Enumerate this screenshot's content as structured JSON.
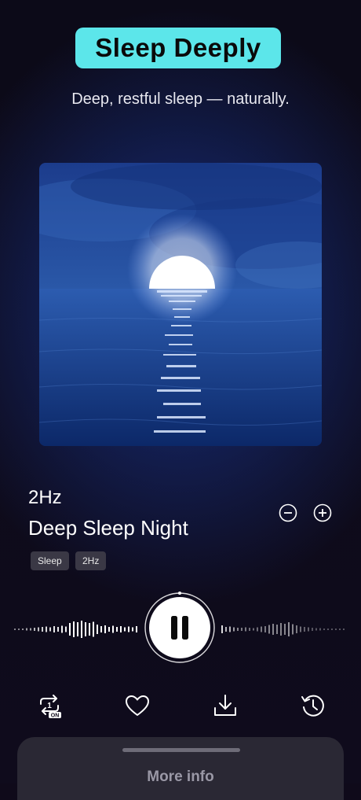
{
  "header": {
    "title": "Sleep Deeply",
    "subtitle": "Deep, restful sleep — naturally."
  },
  "artwork": {
    "description_icon": "moonlit-ocean-image"
  },
  "track": {
    "frequency": "2Hz",
    "name": "Deep Sleep Night",
    "tags": [
      "Sleep",
      "2Hz"
    ]
  },
  "player": {
    "state_icon": "pause-icon",
    "progress": 0.02
  },
  "actions": {
    "repeat_badge": "1",
    "repeat_state": "ON",
    "icons": [
      "repeat-one-icon",
      "heart-icon",
      "download-icon",
      "history-icon"
    ]
  },
  "sheet": {
    "label": "More info"
  },
  "colors": {
    "accent": "#5ce6ea",
    "background": "#0f0a1a"
  }
}
